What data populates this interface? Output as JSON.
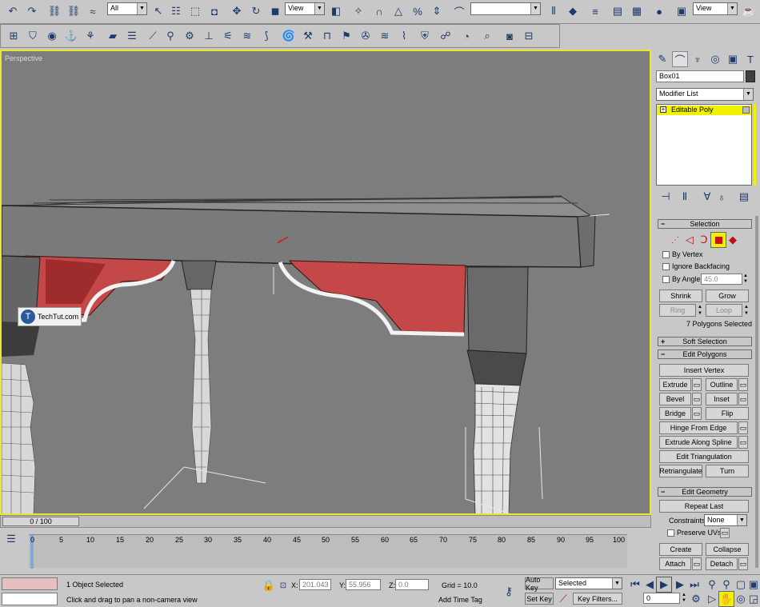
{
  "toolbar_top": {
    "selection_filter": "All",
    "reference_coord": "View",
    "named_selection": "",
    "render_view": "View"
  },
  "viewport": {
    "label": "Perspective",
    "watermark": "TechTut.com"
  },
  "panel": {
    "object_name": "Box01",
    "modifier_list": "Modifier List",
    "stack_item": "Editable Poly",
    "selection": {
      "title": "Selection",
      "by_vertex": "By Vertex",
      "ignore_backfacing": "Ignore Backfacing",
      "by_angle": "By Angle:",
      "angle_value": "45.0",
      "shrink": "Shrink",
      "grow": "Grow",
      "ring": "Ring",
      "loop": "Loop",
      "status": "7 Polygons Selected"
    },
    "soft_selection": "Soft Selection",
    "edit_polygons": {
      "title": "Edit Polygons",
      "insert_vertex": "Insert Vertex",
      "extrude": "Extrude",
      "outline": "Outline",
      "bevel": "Bevel",
      "inset": "Inset",
      "bridge": "Bridge",
      "flip": "Flip",
      "hinge_from_edge": "Hinge From Edge",
      "extrude_along_spline": "Extrude Along Spline",
      "edit_triangulation": "Edit Triangulation",
      "retriangulate": "Retriangulate",
      "turn": "Turn"
    },
    "edit_geometry": {
      "title": "Edit Geometry",
      "repeat_last": "Repeat Last",
      "constraints": "Constraints:",
      "constraints_value": "None",
      "preserve_uvs": "Preserve UVs",
      "create": "Create",
      "collapse": "Collapse",
      "attach": "Attach",
      "detach": "Detach"
    }
  },
  "timeline": {
    "frame_display": "0 / 100",
    "ticks": [
      "0",
      "5",
      "10",
      "15",
      "20",
      "25",
      "30",
      "35",
      "40",
      "45",
      "50",
      "55",
      "60",
      "65",
      "70",
      "75",
      "80",
      "85",
      "90",
      "95",
      "100"
    ]
  },
  "status": {
    "selected": "1 Object Selected",
    "prompt": "Click and drag to pan a non-camera view",
    "x_label": "X:",
    "x_value": "201.043",
    "y_label": "Y:",
    "y_value": "55.956",
    "z_label": "Z:",
    "z_value": "0.0",
    "grid": "Grid = 10.0",
    "add_time_tag": "Add Time Tag",
    "auto_key": "Auto Key",
    "set_key": "Set Key",
    "key_mode": "Selected",
    "key_filters": "Key Filters...",
    "current_frame": "0"
  }
}
